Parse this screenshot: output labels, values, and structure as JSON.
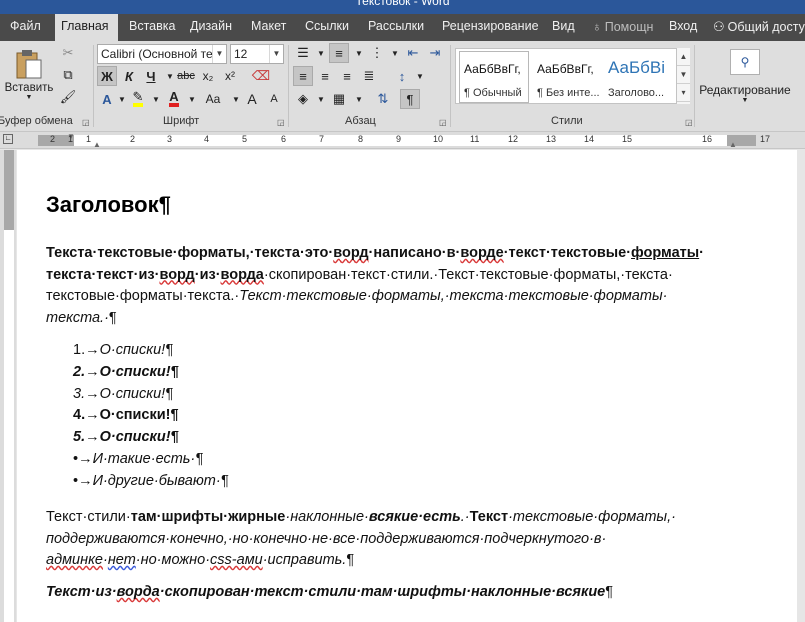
{
  "window": {
    "title": "Текстовок - Word"
  },
  "tabs": [
    {
      "label": "Файл"
    },
    {
      "label": "Главная"
    },
    {
      "label": "Вставка"
    },
    {
      "label": "Дизайн"
    },
    {
      "label": "Макет"
    },
    {
      "label": "Ссылки"
    },
    {
      "label": "Рассылки"
    },
    {
      "label": "Рецензирование"
    },
    {
      "label": "Вид"
    },
    {
      "label": "Помощн"
    },
    {
      "label": "Вход"
    },
    {
      "label": "Общий досту"
    }
  ],
  "ribbon": {
    "clipboard": {
      "paste_label": "Вставить",
      "group_label": "Буфер обмена"
    },
    "font": {
      "font_name": "Calibri (Основной тек",
      "font_size": "12",
      "bold": "Ж",
      "italic": "К",
      "underline": "Ч",
      "strike": "abc",
      "subscript": "x₂",
      "superscript": "x²",
      "grow": "A",
      "shrink": "A",
      "case": "Aa",
      "group_label": "Шрифт"
    },
    "paragraph": {
      "group_label": "Абзац",
      "pilcrow": "¶"
    },
    "styles": {
      "items": [
        {
          "sample": "АаБбВвГг,",
          "name": "¶ Обычный"
        },
        {
          "sample": "АаБбВвГг,",
          "name": "¶ Без инте..."
        },
        {
          "sample": "АаБбВі",
          "name": "Заголово..."
        }
      ],
      "group_label": "Стили"
    },
    "editing": {
      "label": "Редактирование"
    }
  },
  "ruler": {
    "numbers": [
      "2",
      "1",
      "1",
      "2",
      "3",
      "4",
      "5",
      "6",
      "7",
      "8",
      "9",
      "10",
      "11",
      "12",
      "13",
      "14",
      "15",
      "16",
      "17"
    ]
  },
  "document": {
    "heading": "Заголовок¶",
    "p1": {
      "s1": "Текста·текстовые·форматы,·текста·это·",
      "s2": "ворд",
      "s3": "·написано·в·",
      "s4": "ворде",
      "s5": "·текст·текстовые·",
      "s6": "форматы",
      "s7": "·",
      "s8": "текста·текст·из·",
      "s9": "ворд",
      "s10": "·из·",
      "s11": "ворда",
      "s12": "·скопирован·текст·стили.·Текст·текстовые·форматы,·текста·",
      "s13": "текстовые·форматы·текста.·",
      "s14": "Текст·текстовые·форматы,·текста·текстовые·форматы·",
      "s15": "текста.·",
      "s16": "¶"
    },
    "list": [
      {
        "marker": "1.→",
        "text": "О·списки!¶"
      },
      {
        "marker": "2.→",
        "text": "О·списки!¶"
      },
      {
        "marker": "3.→",
        "text": "О·списки!¶"
      },
      {
        "marker": "4.→",
        "text": "О·списки!¶"
      },
      {
        "marker": "5.→",
        "text": "О·списки!¶"
      },
      {
        "marker": "•→",
        "text": "И·такие·есть·¶"
      },
      {
        "marker": "•→",
        "text": "И·другие·бывают·¶"
      }
    ],
    "p2": {
      "s1": "Текст·стили·",
      "s2": "там·шрифты·жирные",
      "s3": "·наклонные·",
      "s4": "всякие·есть",
      "s5": ".·",
      "s6": "Текст",
      "s7": "·текстовые·форматы,·",
      "s8": "поддерживаются·конечно,·но·конечно·не·все·поддерживаются·подчеркнутого·в·",
      "s9": "админке",
      "s10": "·",
      "s11": "нет",
      "s12": "·но·можно·",
      "s13": "css-ами",
      "s14": "·исправить.",
      "s15": "¶"
    },
    "p3": {
      "s1": "Текст·из·",
      "s2": "ворда",
      "s3": "·скопирован·текст·стили·там·шрифты·наклонные·всякие",
      "s4": "¶"
    }
  }
}
